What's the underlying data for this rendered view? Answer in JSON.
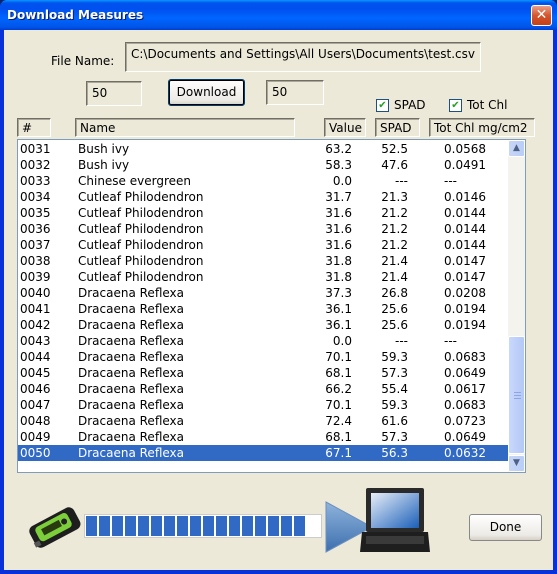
{
  "window": {
    "title": "Download Measures"
  },
  "file": {
    "label": "File Name:",
    "path": "C:\\Documents and Settings\\All Users\\Documents\\test.csv"
  },
  "download": {
    "count_left": "50",
    "button": "Download",
    "count_right": "50"
  },
  "checkboxes": [
    {
      "label": "SPAD",
      "checked": true
    },
    {
      "label": "Tot Chl",
      "checked": true
    }
  ],
  "columns": [
    "#",
    "Name",
    "Value",
    "SPAD",
    "Tot Chl mg/cm2"
  ],
  "rows": [
    [
      "0031",
      "Bush ivy",
      "63.2",
      "52.5",
      "0.0568"
    ],
    [
      "0032",
      "Bush ivy",
      "58.3",
      "47.6",
      "0.0491"
    ],
    [
      "0033",
      "Chinese evergreen",
      "0.0",
      "---",
      "---"
    ],
    [
      "0034",
      "Cutleaf Philodendron",
      "31.7",
      "21.3",
      "0.0146"
    ],
    [
      "0035",
      "Cutleaf Philodendron",
      "31.6",
      "21.2",
      "0.0144"
    ],
    [
      "0036",
      "Cutleaf Philodendron",
      "31.6",
      "21.2",
      "0.0144"
    ],
    [
      "0037",
      "Cutleaf Philodendron",
      "31.6",
      "21.2",
      "0.0144"
    ],
    [
      "0038",
      "Cutleaf Philodendron",
      "31.8",
      "21.4",
      "0.0147"
    ],
    [
      "0039",
      "Cutleaf Philodendron",
      "31.8",
      "21.4",
      "0.0147"
    ],
    [
      "0040",
      "Dracaena Reflexa",
      "37.3",
      "26.8",
      "0.0208"
    ],
    [
      "0041",
      "Dracaena Reflexa",
      "36.1",
      "25.6",
      "0.0194"
    ],
    [
      "0042",
      "Dracaena Reflexa",
      "36.1",
      "25.6",
      "0.0194"
    ],
    [
      "0043",
      "Dracaena Reflexa",
      "0.0",
      "---",
      "---"
    ],
    [
      "0044",
      "Dracaena Reflexa",
      "70.1",
      "59.3",
      "0.0683"
    ],
    [
      "0045",
      "Dracaena Reflexa",
      "68.1",
      "57.3",
      "0.0649"
    ],
    [
      "0046",
      "Dracaena Reflexa",
      "66.2",
      "55.4",
      "0.0617"
    ],
    [
      "0047",
      "Dracaena Reflexa",
      "70.1",
      "59.3",
      "0.0683"
    ],
    [
      "0048",
      "Dracaena Reflexa",
      "72.4",
      "61.6",
      "0.0723"
    ],
    [
      "0049",
      "Dracaena Reflexa",
      "68.1",
      "57.3",
      "0.0649"
    ],
    [
      "0050",
      "Dracaena Reflexa",
      "67.1",
      "56.3",
      "0.0632"
    ]
  ],
  "selected_row": "0050",
  "progress": {
    "percent": 100,
    "blocks": 17
  },
  "icons": {
    "device": "chlorophyll-meter-icon",
    "arrow": "transfer-arrow-icon",
    "computer": "laptop-icon"
  },
  "done_button": "Done",
  "colors": {
    "selection": "#316ac5",
    "progress": "#316ac5",
    "titlebar": "#0055e8"
  }
}
